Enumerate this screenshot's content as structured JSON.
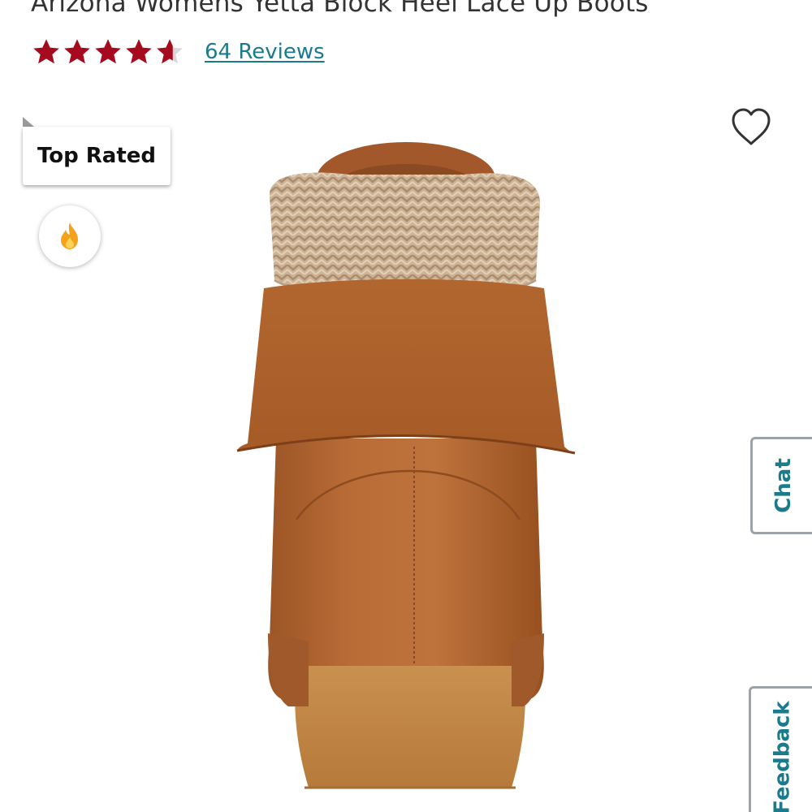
{
  "product": {
    "title": "Arizona Womens Yetta Block Heel Lace Up Boots",
    "rating": 4.5,
    "rating_max": 5,
    "reviews_link": "64 Reviews"
  },
  "badge": {
    "label": "Top Rated"
  },
  "icons": {
    "trending": "fire-icon",
    "favorite": "heart-outline-icon",
    "rating": "star-icon"
  },
  "side_tabs": {
    "chat": "Chat",
    "feedback": "Feedback"
  },
  "colors": {
    "star": "#a50a1f",
    "link": "#1b7a8c",
    "tab_text": "#1b7a8c",
    "fire": "#f3a21a"
  }
}
